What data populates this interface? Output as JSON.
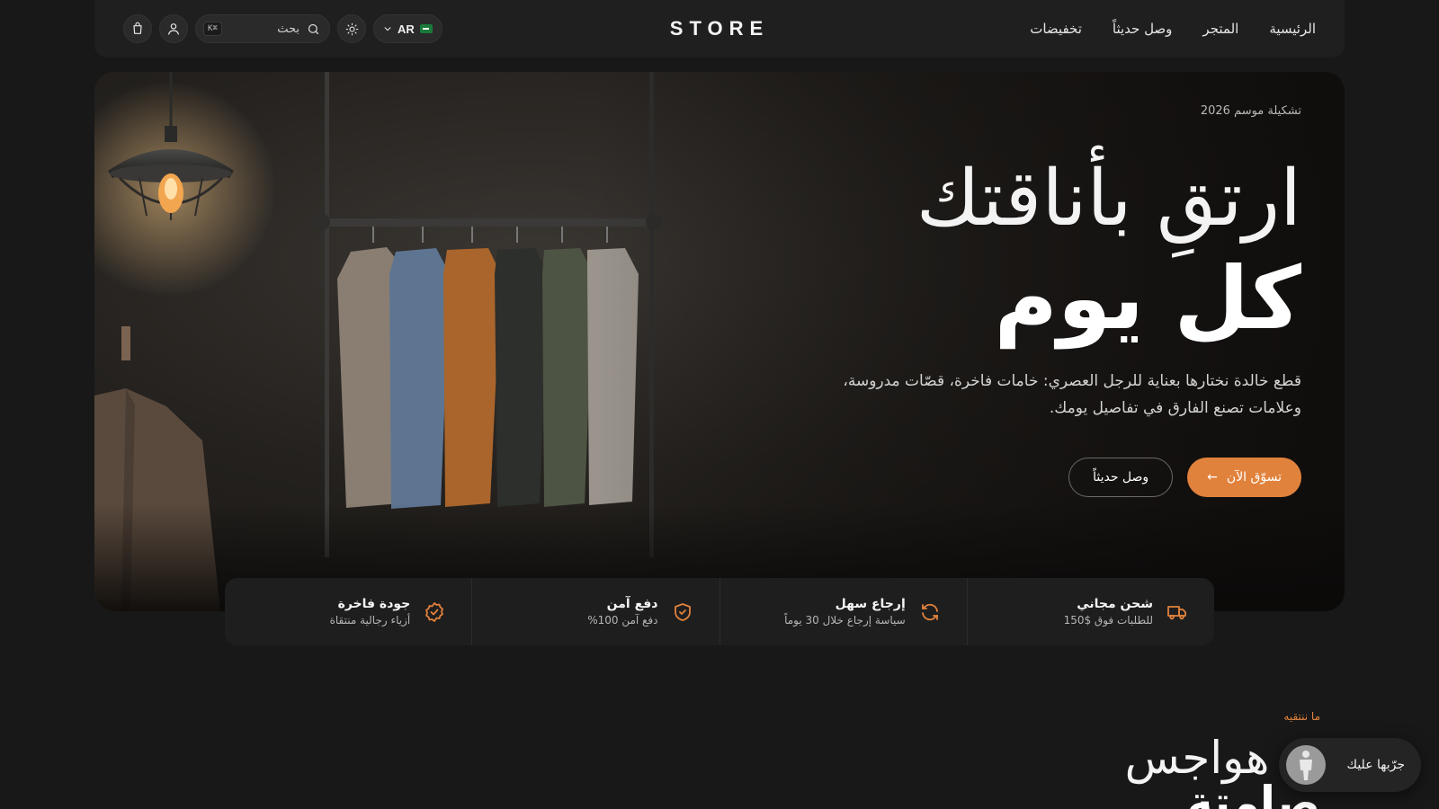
{
  "header": {
    "logo": "STORE",
    "nav": [
      "الرئيسية",
      "المتجر",
      "وصل حديثاً",
      "تخفيضات"
    ],
    "search_label": "بحث",
    "search_shortcut": "K⌘",
    "language": "AR"
  },
  "hero": {
    "eyebrow": "تشكيلة موسم 2026",
    "title_line1": "ارتقِ بأناقتك",
    "title_line2": "كل يوم",
    "description": "قطع خالدة نختارها بعناية للرجل العصري: خامات فاخرة، قصّات مدروسة، وعلامات تصنع الفارق في تفاصيل يومك.",
    "primary_button": "تسوّق الآن",
    "primary_arrow": "←",
    "secondary_button": "وصل حديثاً"
  },
  "features": [
    {
      "title": "شحن مجاني",
      "subtitle": "للطلبات فوق $150",
      "icon": "truck-icon"
    },
    {
      "title": "إرجاع سهل",
      "subtitle": "سياسة إرجاع خلال 30 يوماً",
      "icon": "refresh-icon"
    },
    {
      "title": "دفع آمن",
      "subtitle": "دفع آمن 100%",
      "icon": "shield-icon"
    },
    {
      "title": "جودة فاخرة",
      "subtitle": "أزياء رجالية منتقاة",
      "icon": "badge-check-icon"
    }
  ],
  "section": {
    "eyebrow": "ما ننتقيه",
    "title_line1": "ثة هواجس",
    "title_line2": "صامتة"
  },
  "tryon": {
    "label": "جرّبها عليك"
  },
  "colors": {
    "accent": "#e1823c",
    "background": "#181818",
    "surface": "#1f1f1f"
  }
}
